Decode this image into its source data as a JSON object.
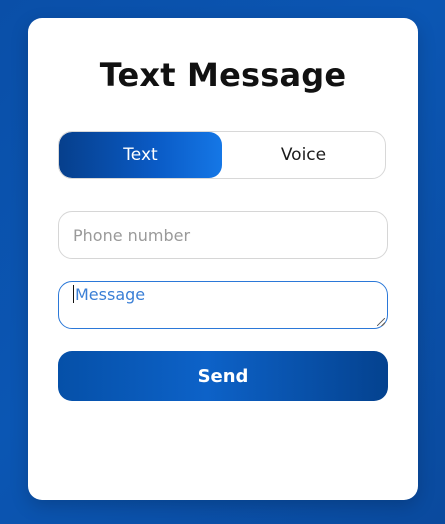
{
  "form": {
    "title": "Text Message",
    "mode_toggle": {
      "options": [
        "Text",
        "Voice"
      ],
      "selected": "Text"
    },
    "phone": {
      "value": "",
      "placeholder": "Phone number"
    },
    "message": {
      "value": "",
      "placeholder": "Message"
    },
    "send_label": "Send"
  },
  "colors": {
    "background": "#0a4fa8",
    "accent": "#0a5bc6",
    "accent_dark": "#063f8c",
    "card": "#ffffff",
    "focus_border": "#2b78d8"
  }
}
